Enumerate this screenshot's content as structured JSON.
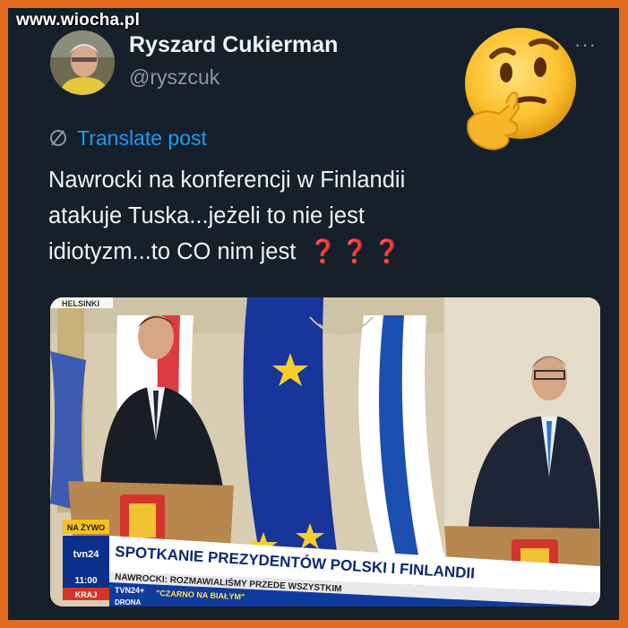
{
  "watermark": "www.wiocha.pl",
  "tweet": {
    "display_name": "Ryszard Cukierman",
    "handle": "@ryszcuk",
    "more_label": "···",
    "translate_label": "Translate post",
    "text_lines": [
      "Nawrocki na konferencji w Finlandii",
      "atakuje Tuska...jeżeli to nie jest",
      "idiotyzm...to CO nim jest"
    ],
    "question_marks": "❓❓❓"
  },
  "media": {
    "location_label": "HELSINKI",
    "live_label": "NA ŻYWO",
    "channel_logo": "tvn24",
    "headline": "SPOTKANIE PREZYDENTÓW POLSKI I FINLANDII",
    "subheadline": "NAWROCKI: ROZMAWIALIŚMY PRZEDE WSZYSTKIM",
    "time": "11:00",
    "ticker_channel": "TVN24+",
    "ticker_text": "\"CZARNO NA BIAŁYM\"",
    "ticker_section": "KRAJ",
    "ticker_text2": "DRONA"
  },
  "icons": {
    "translate": "globe-slash-icon",
    "emoji": "thinking-face-icon",
    "more": "more-options-icon"
  },
  "colors": {
    "frame": "#e06a1f",
    "background": "#15202b",
    "link": "#1d9bf0",
    "text": "#f1f3f5",
    "muted": "#8b98a5"
  }
}
